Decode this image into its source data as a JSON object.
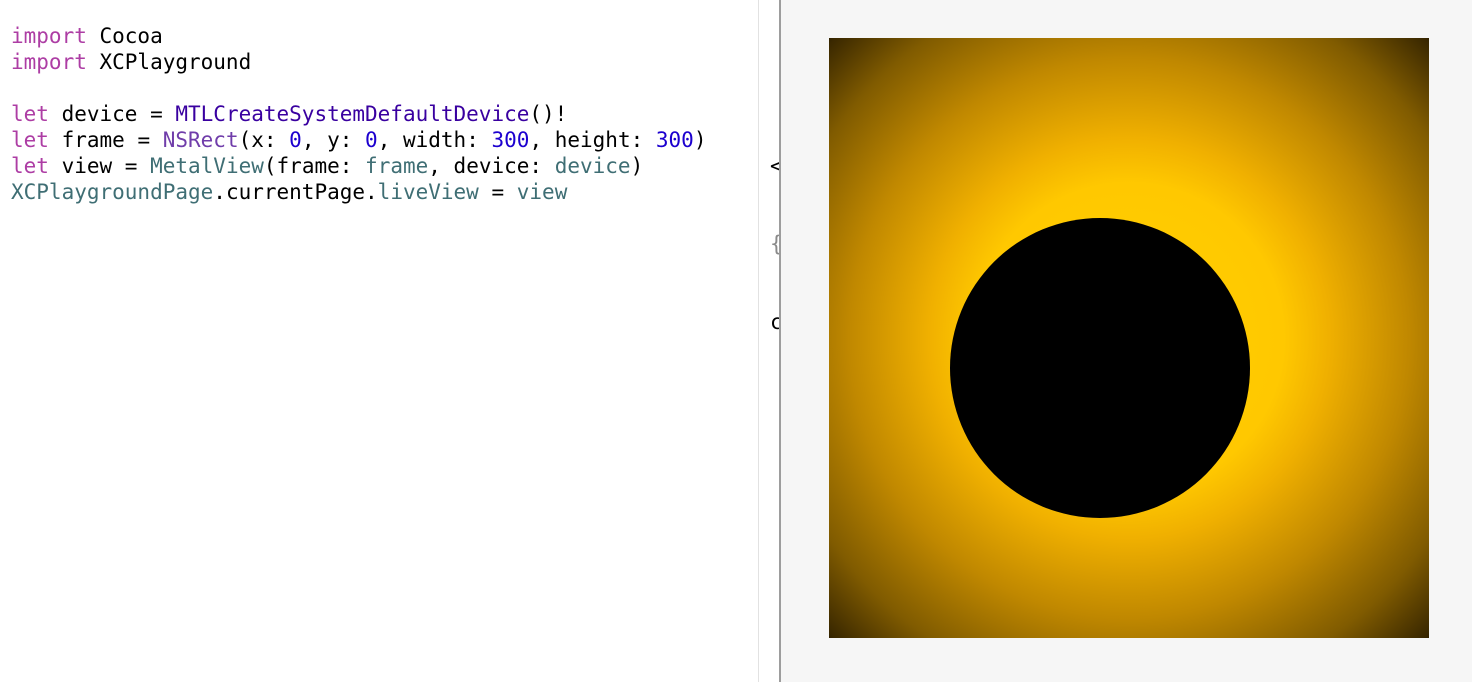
{
  "editor": {
    "lines": [
      {
        "kw": "import",
        "rest": " Cocoa"
      },
      {
        "kw": "import",
        "rest": " XCPlayground"
      },
      {
        "kw": "",
        "rest": ""
      },
      {
        "kw": "let",
        "a": " device = ",
        "b": "MTLCreateSystemDefaultDevice",
        "c": "()!"
      },
      {
        "kw": "let",
        "a": " frame = ",
        "b": "NSRect",
        "c": "(x: ",
        "n1": "0",
        "d": ", y: ",
        "n2": "0",
        "e": ", width: ",
        "n3": "300",
        "f": ", height: ",
        "n4": "300",
        "g": ")"
      },
      {
        "kw": "let",
        "a": " view = ",
        "b": "MetalView",
        "c": "(frame: ",
        "v1": "frame",
        "d": ", device: ",
        "v2": "device",
        "e": ")"
      },
      {
        "t1": "XCPlaygroundPage",
        "t2": ".currentPage.",
        "t3": "liveView",
        "t4": " = ",
        "t5": "view"
      }
    ]
  },
  "results": {
    "lines": [
      "<",
      "{",
      "c"
    ]
  },
  "live_view": {
    "glow_color": "#ffc800",
    "disc_color": "#000000",
    "background": "#f6f6f6"
  }
}
